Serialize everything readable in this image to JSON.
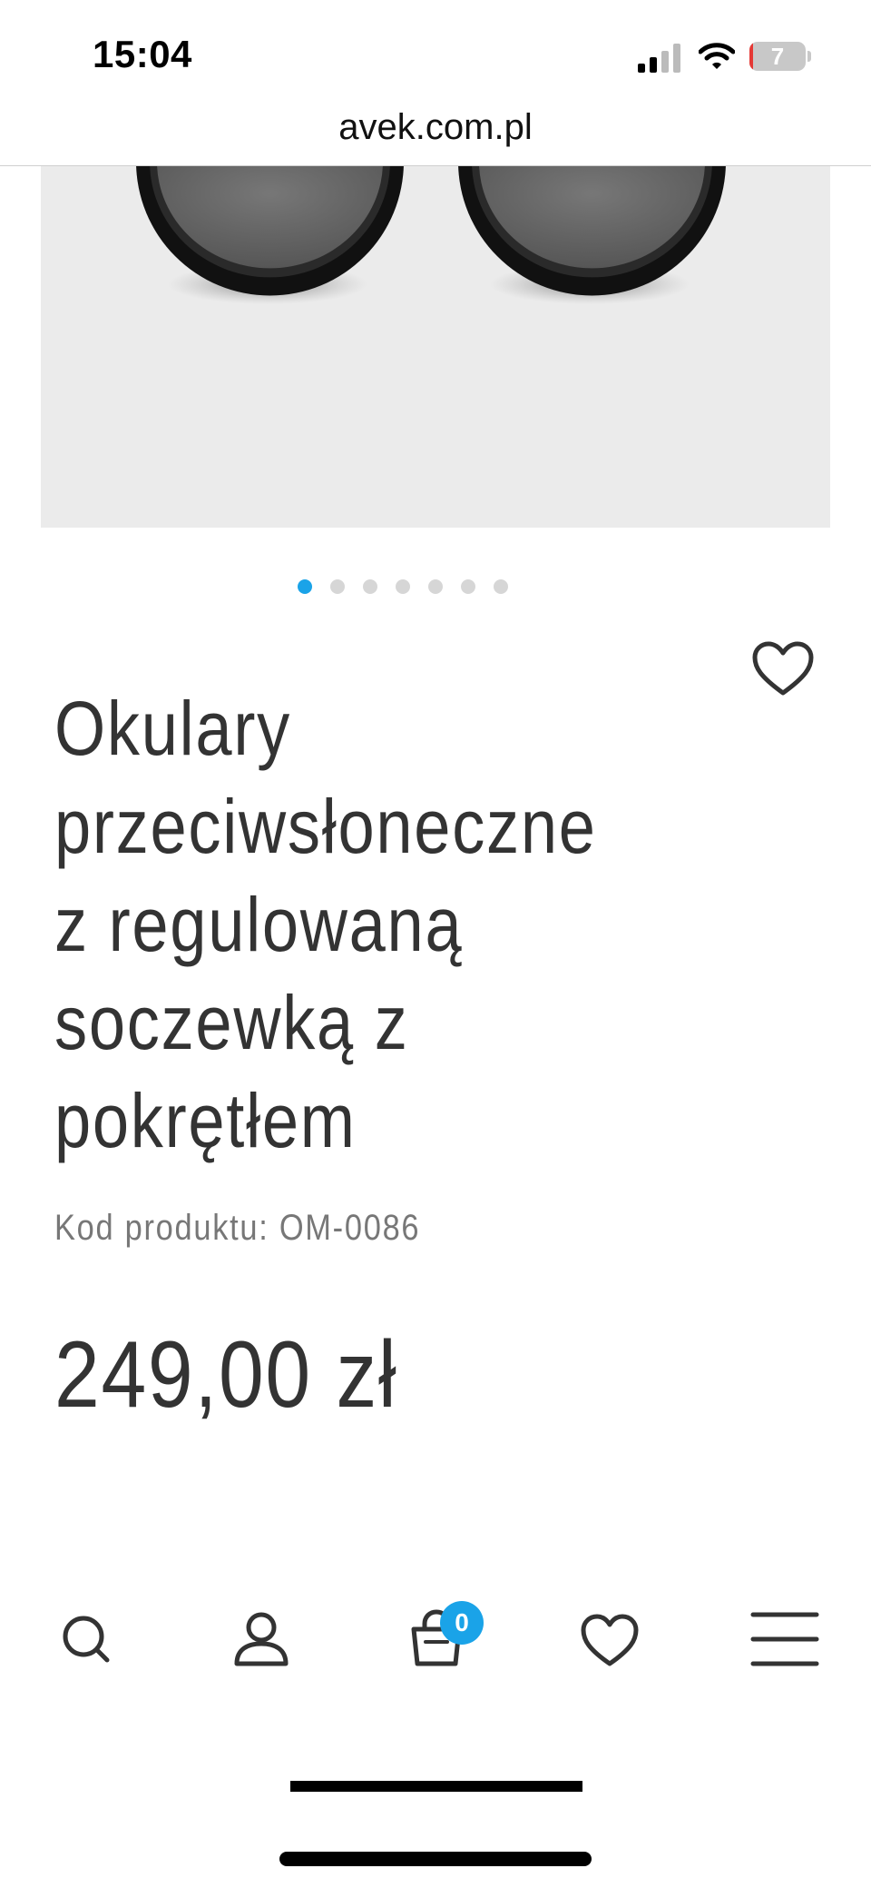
{
  "status_bar": {
    "time": "15:04",
    "battery_percent": "7",
    "battery_level": 0.07,
    "signal_icon": "cellular-signal-icon",
    "wifi_icon": "wifi-icon"
  },
  "browser": {
    "url": "avek.com.pl"
  },
  "gallery": {
    "slides_total": 7,
    "active_slide": 1,
    "accent_color": "#1aa3e8"
  },
  "product": {
    "title_lines": [
      "Okulary",
      "przeciwsłoneczne",
      "z regulowaną",
      "soczewką z",
      "pokrętłem"
    ],
    "code": "Kod produktu: OM-0086",
    "price": "249,00 zł"
  },
  "bottom_nav": {
    "items": [
      {
        "name": "search",
        "icon": "search-icon"
      },
      {
        "name": "account",
        "icon": "user-icon"
      },
      {
        "name": "cart",
        "icon": "shopping-bag-icon"
      },
      {
        "name": "wishlist",
        "icon": "heart-icon"
      },
      {
        "name": "menu",
        "icon": "hamburger-menu-icon"
      }
    ],
    "cart_count": "0"
  }
}
